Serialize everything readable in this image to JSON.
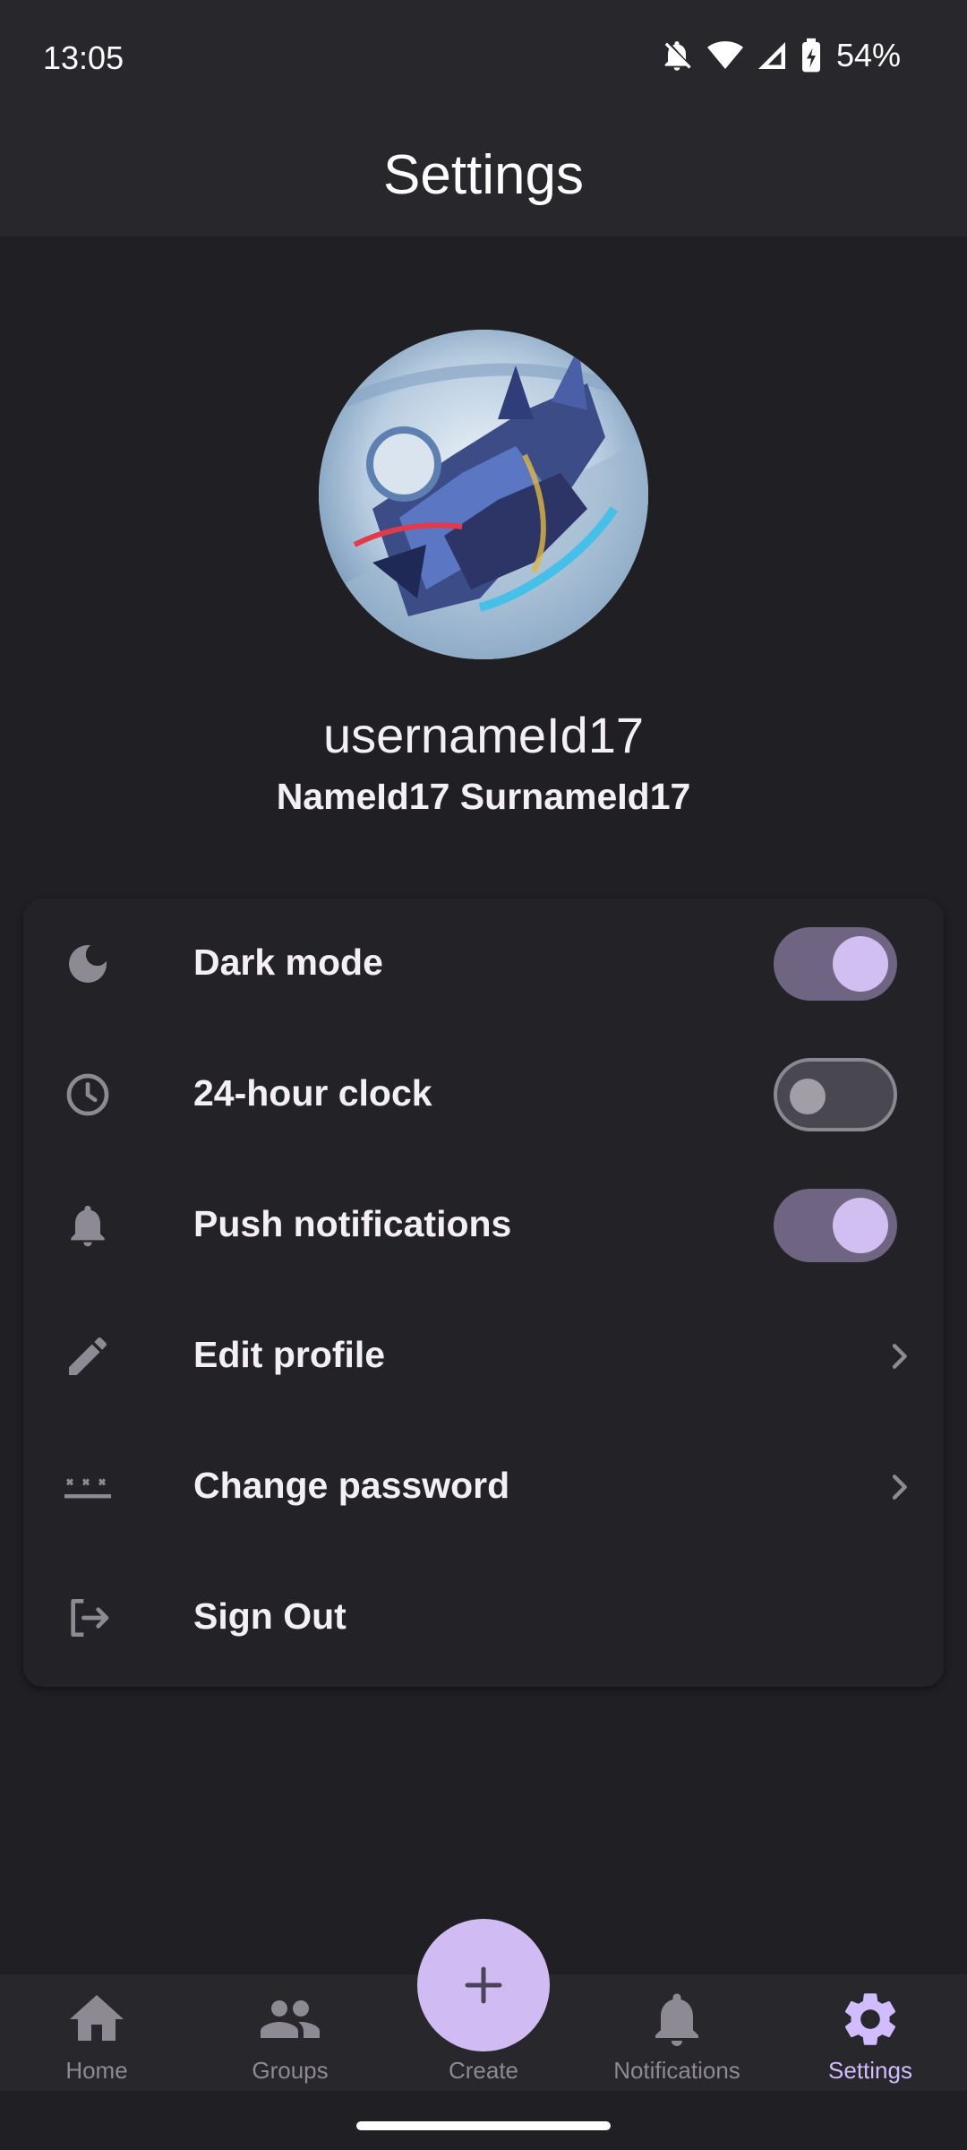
{
  "status_bar": {
    "time": "13:05",
    "battery_percent": "54%",
    "icons": [
      "notifications-off-icon",
      "wifi-icon",
      "cell-signal-icon",
      "battery-charging-icon"
    ]
  },
  "app_bar": {
    "title": "Settings"
  },
  "profile": {
    "avatar_description": "avatar-image",
    "username": "usernameId17",
    "full_name": "NameId17 SurnameId17"
  },
  "settings": {
    "items": [
      {
        "label": "Dark mode",
        "icon": "moon-icon",
        "control": "toggle",
        "value": true
      },
      {
        "label": "24-hour clock",
        "icon": "clock-icon",
        "control": "toggle",
        "value": false
      },
      {
        "label": "Push notifications",
        "icon": "bell-icon",
        "control": "toggle",
        "value": true
      },
      {
        "label": "Edit profile",
        "icon": "pencil-icon",
        "control": "chevron"
      },
      {
        "label": "Change password",
        "icon": "password-icon",
        "control": "chevron"
      },
      {
        "label": "Sign Out",
        "icon": "logout-icon",
        "control": "none"
      }
    ]
  },
  "bottom_nav": {
    "items": [
      {
        "label": "Home",
        "icon": "home-icon",
        "active": false
      },
      {
        "label": "Groups",
        "icon": "groups-icon",
        "active": false
      },
      {
        "label": "Create",
        "icon": "plus-icon",
        "active": false
      },
      {
        "label": "Notifications",
        "icon": "bell-icon",
        "active": false
      },
      {
        "label": "Settings",
        "icon": "gear-icon",
        "active": true
      }
    ]
  },
  "colors": {
    "background": "#201f24",
    "bar": "#28272b",
    "accent": "#d0bcff",
    "toggle_on_track": "#6f6583",
    "icon_gray": "#8d8a93"
  }
}
